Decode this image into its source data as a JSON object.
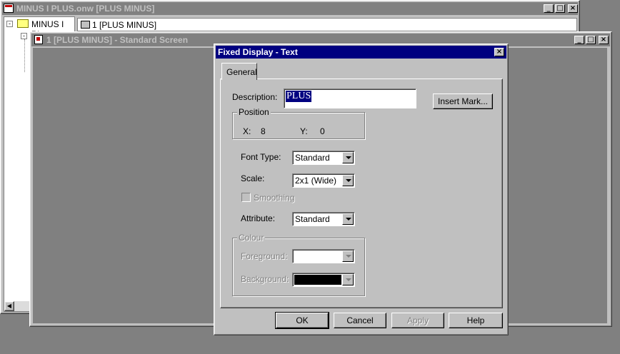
{
  "main_window": {
    "title": "MINUS I PLUS.onw [PLUS MINUS]",
    "tree_node": "MINUS I PL",
    "address_item": "1 [PLUS MINUS]"
  },
  "child_window": {
    "title": "1 [PLUS MINUS] - Standard Screen"
  },
  "dialog": {
    "title": "Fixed Display - Text",
    "tab_general": "General",
    "description_label": "Description:",
    "description_value": "PLUS",
    "insert_mark_button": "Insert Mark...",
    "position_legend": "Position",
    "x_label": "X:",
    "x_value": "8",
    "y_label": "Y:",
    "y_value": "0",
    "font_type_label": "Font Type:",
    "font_type_value": "Standard",
    "scale_label": "Scale:",
    "scale_value": "2x1 (Wide)",
    "smoothing_label": "Smoothing",
    "attribute_label": "Attribute:",
    "attribute_value": "Standard",
    "colour_legend": "Colour",
    "foreground_label": "Foreground:",
    "background_label": "Background:",
    "ok_button": "OK",
    "cancel_button": "Cancel",
    "apply_button": "Apply",
    "help_button": "Help",
    "foreground_color": "#ffffff",
    "background_color": "#000000"
  }
}
